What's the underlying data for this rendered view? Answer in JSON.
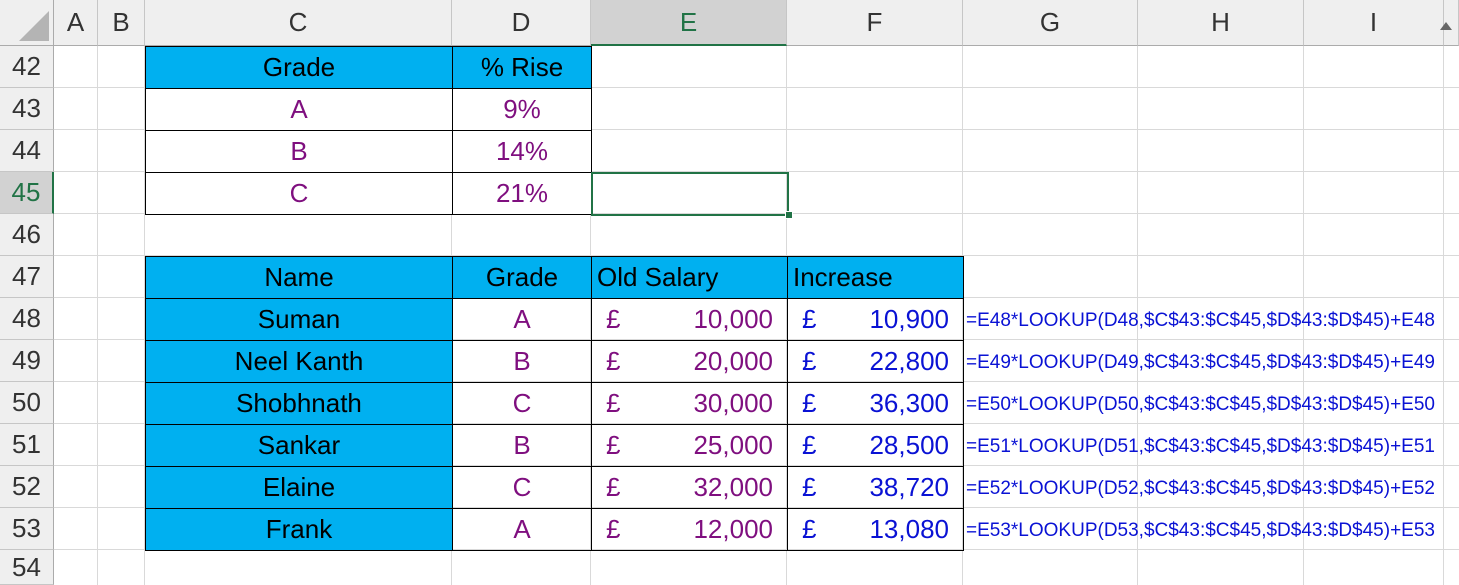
{
  "columns": [
    "A",
    "B",
    "C",
    "D",
    "E",
    "F",
    "G",
    "H",
    "I"
  ],
  "rows": [
    "42",
    "43",
    "44",
    "45",
    "46",
    "47",
    "48",
    "49",
    "50",
    "51",
    "52",
    "53",
    "54"
  ],
  "rate_table": {
    "header": [
      "Grade",
      "% Rise"
    ],
    "rows": [
      {
        "grade": "A",
        "rise": "9%"
      },
      {
        "grade": "B",
        "rise": "14%"
      },
      {
        "grade": "C",
        "rise": "21%"
      }
    ]
  },
  "salary_table": {
    "header": [
      "Name",
      "Grade",
      "Old Salary",
      "Increase"
    ],
    "currency": "£",
    "rows": [
      {
        "name": "Suman",
        "grade": "A",
        "old": "10,000",
        "increase": "10,900",
        "formula": "=E48*LOOKUP(D48,$C$43:$C$45,$D$43:$D$45)+E48"
      },
      {
        "name": "Neel Kanth",
        "grade": "B",
        "old": "20,000",
        "increase": "22,800",
        "formula": "=E49*LOOKUP(D49,$C$43:$C$45,$D$43:$D$45)+E49"
      },
      {
        "name": "Shobhnath",
        "grade": "C",
        "old": "30,000",
        "increase": "36,300",
        "formula": "=E50*LOOKUP(D50,$C$43:$C$45,$D$43:$D$45)+E50"
      },
      {
        "name": "Sankar",
        "grade": "B",
        "old": "25,000",
        "increase": "28,500",
        "formula": "=E51*LOOKUP(D51,$C$43:$C$45,$D$43:$D$45)+E51"
      },
      {
        "name": "Elaine",
        "grade": "C",
        "old": "32,000",
        "increase": "38,720",
        "formula": "=E52*LOOKUP(D52,$C$43:$C$45,$D$43:$D$45)+E52"
      },
      {
        "name": "Frank",
        "grade": "A",
        "old": "12,000",
        "increase": "13,080",
        "formula": "=E53*LOOKUP(D53,$C$43:$C$45,$D$43:$D$45)+E53"
      }
    ]
  },
  "selection": {
    "cell": "E45",
    "column": "E",
    "row": "45"
  },
  "colors": {
    "header_fill": "#00b0f0",
    "purple_text": "#7f0f7f",
    "blue_text": "#0a12d4",
    "selection": "#217346"
  }
}
